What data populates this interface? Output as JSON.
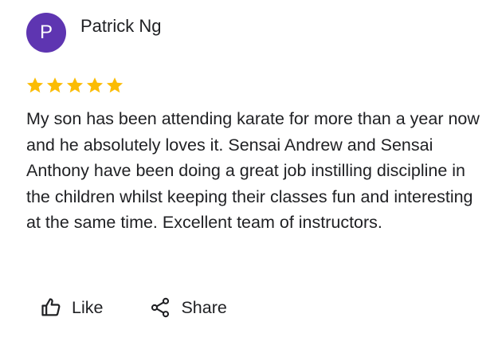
{
  "review": {
    "author_initial": "P",
    "author_name": "Patrick Ng",
    "rating": 5,
    "rating_max": 5,
    "text": "My son has been attending karate for more than a year now and he absolutely loves it. Sensai Andrew and Sensai Anthony have been doing a great job instilling discipline in the children whilst keeping their classes fun and interesting at the same time. Excellent team of instructors."
  },
  "actions": {
    "like_label": "Like",
    "share_label": "Share"
  },
  "colors": {
    "avatar_bg": "#5e35b1",
    "star": "#fbbc04",
    "text": "#202124"
  },
  "icons": {
    "like": "thumb-up-icon",
    "share": "share-icon",
    "star": "star-icon"
  }
}
